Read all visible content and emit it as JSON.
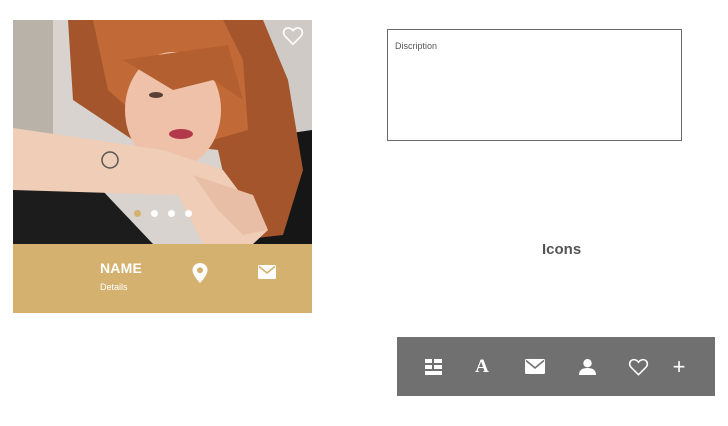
{
  "profile_card": {
    "name": "NAME",
    "details": "Details",
    "carousel": {
      "count": 4,
      "active_index": 0
    },
    "colors": {
      "bar": "#d4b16e",
      "active_dot": "#d4b16e"
    },
    "icons": {
      "favorite": "heart-outline-icon",
      "location": "location-pin-icon",
      "mail": "mail-icon"
    }
  },
  "description": {
    "label": "Discription"
  },
  "icons_section": {
    "title": "Icons",
    "toolbar": {
      "background": "#707070",
      "items": [
        {
          "icon": "list-icon"
        },
        {
          "icon": "font-icon",
          "glyph": "A"
        },
        {
          "icon": "mail-icon"
        },
        {
          "icon": "user-icon"
        },
        {
          "icon": "heart-outline-icon"
        },
        {
          "icon": "plus-icon",
          "glyph": "+"
        }
      ]
    }
  }
}
